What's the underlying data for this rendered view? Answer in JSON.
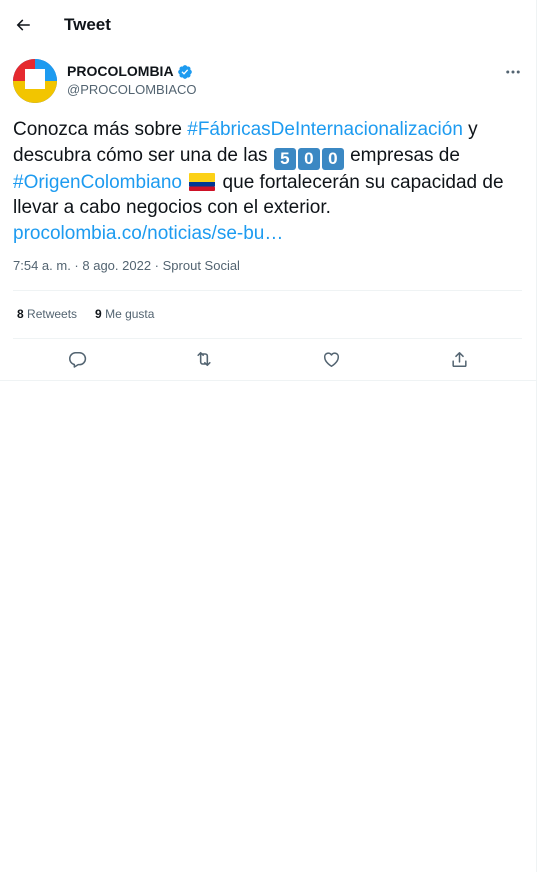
{
  "header": {
    "title": "Tweet",
    "back_icon": "arrow-left-icon"
  },
  "author": {
    "name": "PROCOLOMBIA",
    "handle": "@PROCOLOMBIACO",
    "verified": true,
    "verified_color": "#1d9bf0"
  },
  "tweet": {
    "part1": "Conozca más sobre ",
    "hashtag1": "#FábricasDeInternacionalización",
    "part2": " y descubra cómo ser una de las ",
    "keycaps": [
      "5",
      "0",
      "0"
    ],
    "part3": " empresas de ",
    "hashtag2": "#OrigenColombiano",
    "part4": " que fortalecerán su capacidad de llevar a cabo negocios con el exterior.",
    "link": "procolombia.co/noticias/se-bu…"
  },
  "meta": {
    "time": "7:54 a. m.",
    "sep1": " · ",
    "date": "8 ago. 2022",
    "sep2": " · ",
    "source": "Sprout Social"
  },
  "stats": {
    "retweets_count": "8",
    "retweets_label": " Retweets",
    "likes_count": "9",
    "likes_label": " Me gusta"
  },
  "actions": [
    "reply-icon",
    "retweet-icon",
    "like-icon",
    "share-icon"
  ],
  "colors": {
    "link": "#1d9bf0",
    "secondary_text": "#536471",
    "border": "#eff3f4",
    "keycap": "#3b88c3"
  }
}
